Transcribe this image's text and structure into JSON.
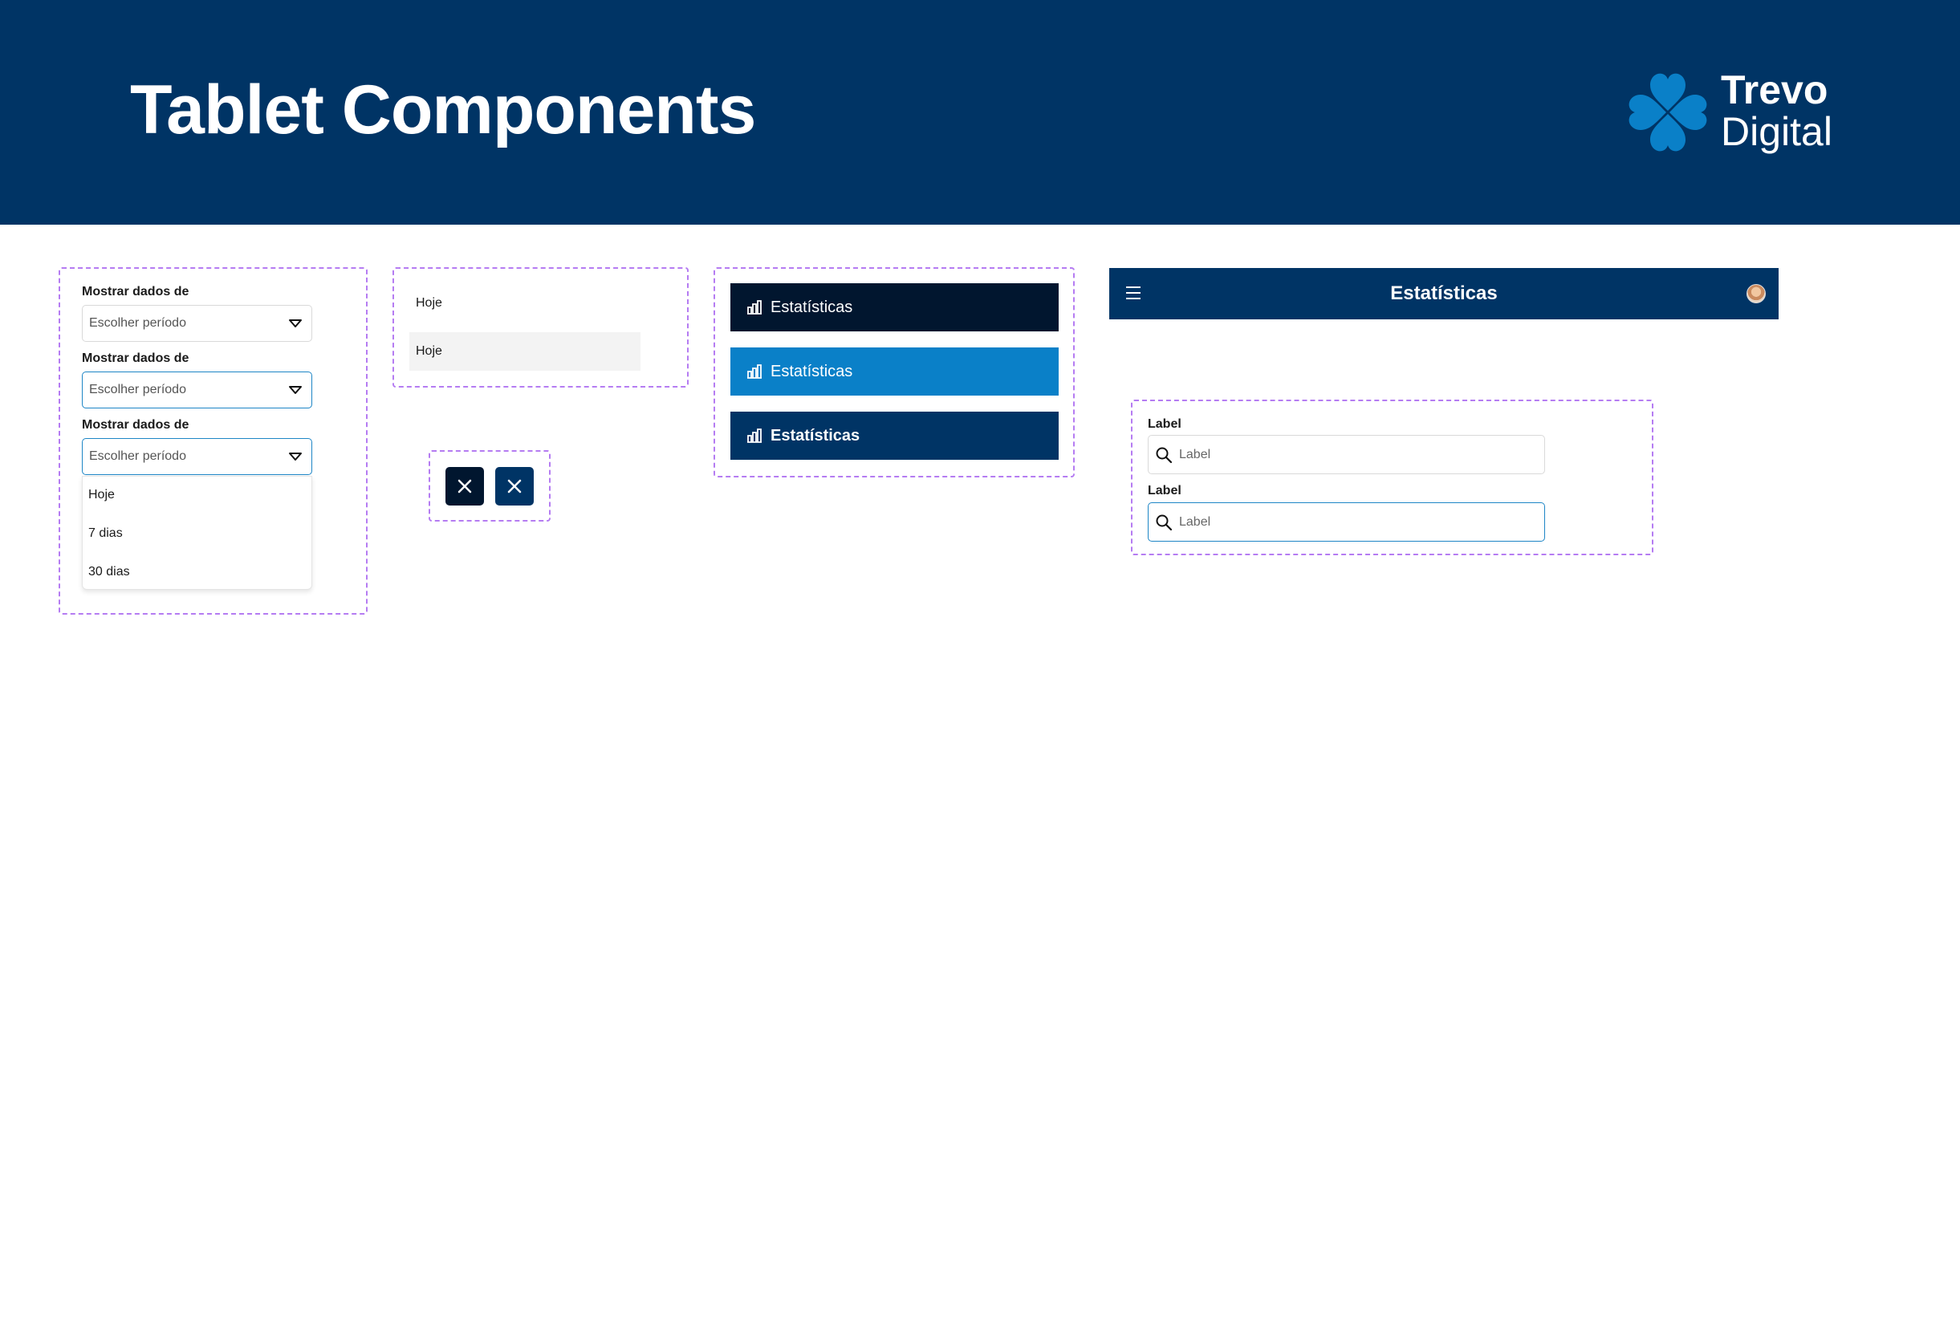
{
  "header": {
    "title": "Tablet Components",
    "logo": {
      "line1": "Trevo",
      "line2": "Digital",
      "icon": "clover-icon"
    }
  },
  "selects": {
    "label": "Mostrar dados de",
    "placeholder": "Escolher período",
    "options": [
      "Hoje",
      "7 dias",
      "30 dias"
    ]
  },
  "list_items": {
    "default_label": "Hoje",
    "hover_label": "Hoje"
  },
  "close_buttons": {
    "icon": "close-icon"
  },
  "nav_items": [
    {
      "label": "Estatísticas",
      "state": "default",
      "bg": "#01162f"
    },
    {
      "label": "Estatísticas",
      "state": "hover",
      "bg": "#0a80c8"
    },
    {
      "label": "Estatísticas",
      "state": "active",
      "bg": "#003465"
    }
  ],
  "topbar": {
    "title": "Estatísticas",
    "menu_icon": "hamburger-icon",
    "avatar": "user-avatar"
  },
  "search_fields": {
    "label": "Label",
    "placeholder": "Label",
    "icon": "search-icon"
  },
  "colors": {
    "primary": "#003465",
    "accent": "#1e86c6",
    "dark": "#01162f",
    "frame": "#b57cf2"
  }
}
